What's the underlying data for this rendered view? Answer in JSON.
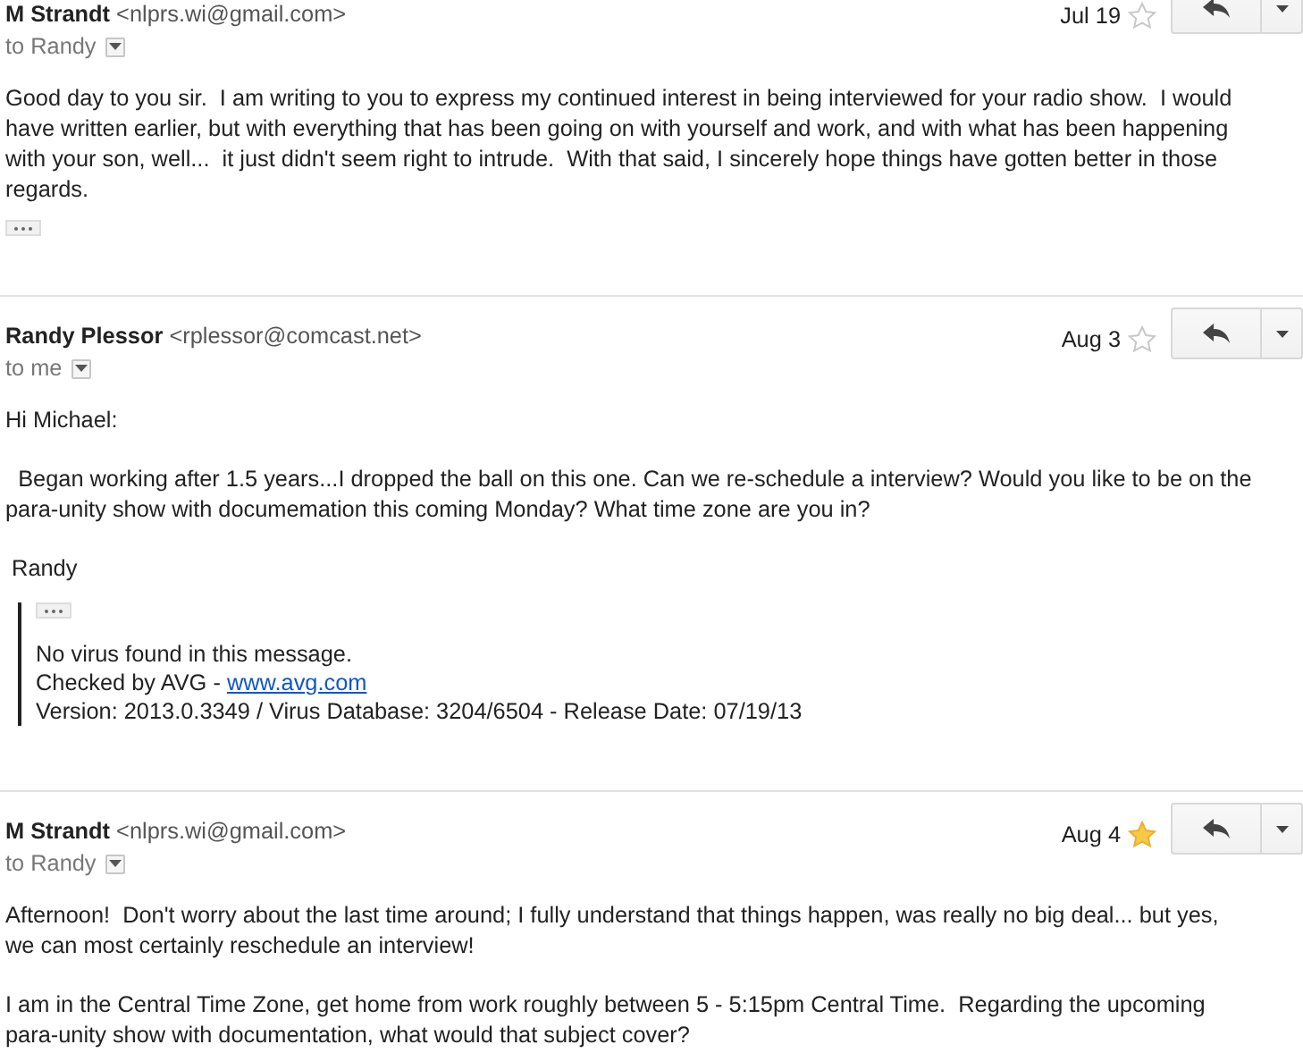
{
  "messages": [
    {
      "sender": "M Strandt",
      "email": "<nlprs.wi@gmail.com>",
      "date": "Jul 19",
      "starred": false,
      "to": "to Randy",
      "paragraphs": [
        "Good day to you sir.  I am writing to you to express my continued interest in being interviewed for your radio show.  I would have written earlier, but with everything that has been going on with yourself and work, and with what has been happening with your son, well...  it just didn't seem right to intrude.  With that said, I sincerely hope things have gotten better in those regards."
      ],
      "trimmed": true
    },
    {
      "sender": "Randy Plessor",
      "email": "<rplessor@comcast.net>",
      "date": "Aug 3",
      "starred": false,
      "to": "to me",
      "paragraphs": [
        "Hi Michael:",
        "  Began working after 1.5 years...I dropped the ball on this one. Can we re-schedule a interview? Would you like to be on the para-unity show with documemation this coming Monday? What time zone are you in?",
        " Randy"
      ],
      "quote": {
        "trimmed": true,
        "lines": [
          {
            "text": "No virus found in this message."
          },
          {
            "text": "Checked by AVG - ",
            "link": "www.avg.com"
          },
          {
            "text": "Version: 2013.0.3349 / Virus Database: 3204/6504 - Release Date: 07/19/13"
          }
        ]
      }
    },
    {
      "sender": "M Strandt",
      "email": "<nlprs.wi@gmail.com>",
      "date": "Aug 4",
      "starred": true,
      "to": "to Randy",
      "paragraphs": [
        "Afternoon!  Don't worry about the last time around; I fully understand that things happen, was really no big deal... but yes, we can most certainly reschedule an interview!",
        "I am in the Central Time Zone, get home from work roughly between 5 - 5:15pm Central Time.  Regarding the upcoming para-unity show with documentation, what would that subject cover?"
      ]
    }
  ]
}
